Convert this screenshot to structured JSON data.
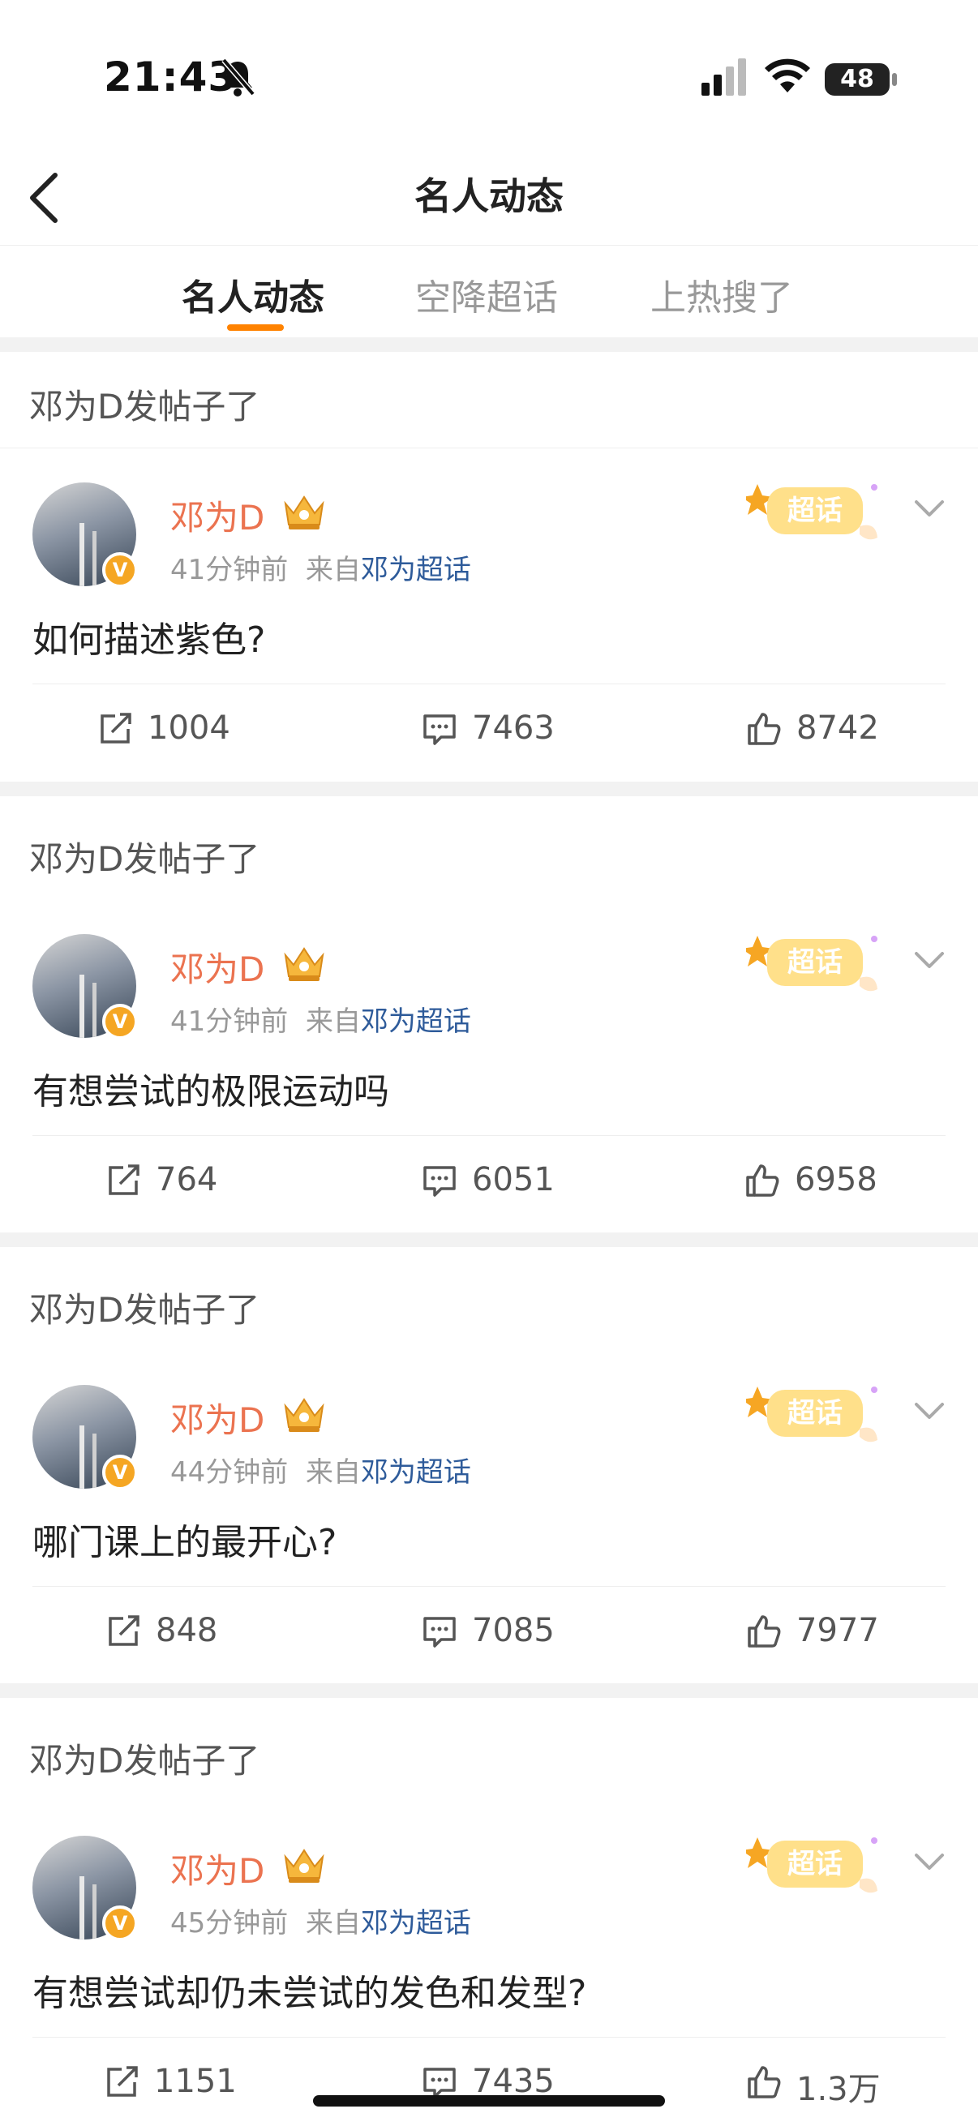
{
  "status_bar": {
    "time": "21:43",
    "battery": "48"
  },
  "header": {
    "title": "名人动态"
  },
  "tabs": [
    {
      "label": "名人动态",
      "active": true
    },
    {
      "label": "空降超话",
      "active": false
    },
    {
      "label": "上热搜了",
      "active": false
    }
  ],
  "posts": [
    {
      "section_title": "邓为D发帖子了",
      "author": "邓为D",
      "time_ago": "41分钟前",
      "from_prefix": "来自",
      "source": "邓为超话",
      "text": "如何描述紫色?",
      "reposts": "1004",
      "comments": "7463",
      "likes": "8742"
    },
    {
      "section_title": "邓为D发帖子了",
      "author": "邓为D",
      "time_ago": "41分钟前",
      "from_prefix": "来自",
      "source": "邓为超话",
      "text": "有想尝试的极限运动吗",
      "reposts": "764",
      "comments": "6051",
      "likes": "6958"
    },
    {
      "section_title": "邓为D发帖子了",
      "author": "邓为D",
      "time_ago": "44分钟前",
      "from_prefix": "来自",
      "source": "邓为超话",
      "text": "哪门课上的最开心?",
      "reposts": "848",
      "comments": "7085",
      "likes": "7977"
    },
    {
      "section_title": "邓为D发帖子了",
      "author": "邓为D",
      "time_ago": "45分钟前",
      "from_prefix": "来自",
      "source": "邓为超话",
      "text": "有想尝试却仍未尝试的发色和发型?",
      "reposts": "1151",
      "comments": "7435",
      "likes": "1.3万"
    }
  ],
  "badge": {
    "super_topic": "超话",
    "verified": "V"
  },
  "colors": {
    "accent": "#ff8200",
    "author": "#eb7350",
    "link": "#2e5b9a"
  }
}
